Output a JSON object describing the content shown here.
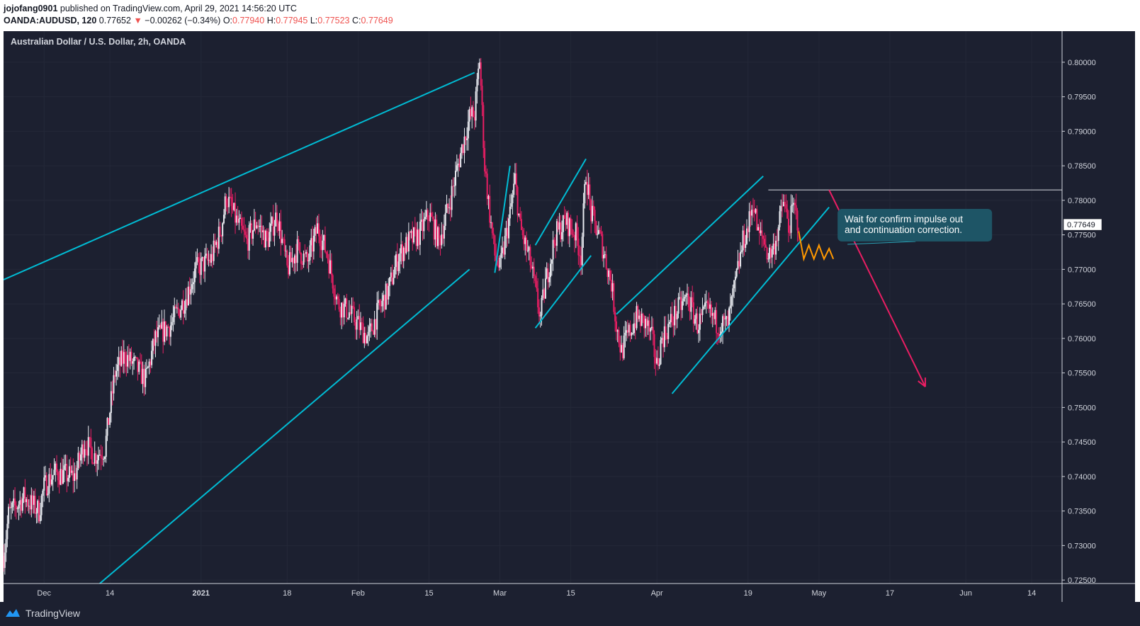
{
  "header": {
    "author": "jojofang0901",
    "published_text": "published on TradingView.com, April 29, 2021 14:56:20 UTC",
    "symbol": "OANDA:AUDUSD, 120",
    "last": "0.77652",
    "change": "−0.00262 (−0.34%)",
    "o_label": "O:",
    "o": "0.77940",
    "h_label": "H:",
    "h": "0.77945",
    "l_label": "L:",
    "l": "0.77523",
    "c_label": "C:",
    "c": "0.77649"
  },
  "footer": {
    "brand": "TradingView"
  },
  "colors": {
    "background": "#1c2030",
    "up": "#e8eaf0",
    "down": "#e91e63",
    "trendline": "#00bcd4",
    "arrow": "#e91e63",
    "wave": "#ff9800",
    "note_bg": "#1e5566"
  },
  "chart_data": {
    "type": "candlestick",
    "title": "Australian Dollar / U.S. Dollar, 2h, OANDA",
    "ylim": [
      0.7245,
      0.8045
    ],
    "y_ticks": [
      "0.80000",
      "0.79500",
      "0.79000",
      "0.78500",
      "0.78000",
      "0.77500",
      "0.77000",
      "0.76500",
      "0.76000",
      "0.75500",
      "0.75000",
      "0.74500",
      "0.74000",
      "0.73500",
      "0.73000",
      "0.72500"
    ],
    "y_tick_values": [
      0.8,
      0.795,
      0.79,
      0.785,
      0.78,
      0.775,
      0.77,
      0.765,
      0.76,
      0.755,
      0.75,
      0.745,
      0.74,
      0.735,
      0.73,
      0.725
    ],
    "x_ticks": [
      {
        "label": "Dec",
        "date": "2020-12-01",
        "bold": false
      },
      {
        "label": "14",
        "date": "2020-12-14",
        "bold": false
      },
      {
        "label": "2021",
        "date": "2021-01-01",
        "bold": true
      },
      {
        "label": "18",
        "date": "2021-01-18",
        "bold": false
      },
      {
        "label": "Feb",
        "date": "2021-02-01",
        "bold": false
      },
      {
        "label": "15",
        "date": "2021-02-15",
        "bold": false
      },
      {
        "label": "Mar",
        "date": "2021-03-01",
        "bold": false
      },
      {
        "label": "15",
        "date": "2021-03-15",
        "bold": false
      },
      {
        "label": "Apr",
        "date": "2021-04-01",
        "bold": false
      },
      {
        "label": "19",
        "date": "2021-04-19",
        "bold": false
      },
      {
        "label": "May",
        "date": "2021-05-03",
        "bold": false
      },
      {
        "label": "17",
        "date": "2021-05-17",
        "bold": false
      },
      {
        "label": "Jun",
        "date": "2021-06-01",
        "bold": false
      },
      {
        "label": "14",
        "date": "2021-06-14",
        "bold": false
      }
    ],
    "price_path": [
      {
        "date": "2020-11-23",
        "price": 0.7285
      },
      {
        "date": "2020-11-24",
        "price": 0.7345
      },
      {
        "date": "2020-11-27",
        "price": 0.737
      },
      {
        "date": "2020-11-30",
        "price": 0.735
      },
      {
        "date": "2020-12-01",
        "price": 0.7385
      },
      {
        "date": "2020-12-03",
        "price": 0.7405
      },
      {
        "date": "2020-12-07",
        "price": 0.74
      },
      {
        "date": "2020-12-09",
        "price": 0.745
      },
      {
        "date": "2020-12-11",
        "price": 0.743
      },
      {
        "date": "2020-12-13",
        "price": 0.744
      },
      {
        "date": "2020-12-15",
        "price": 0.755
      },
      {
        "date": "2020-12-17",
        "price": 0.7575
      },
      {
        "date": "2020-12-19",
        "price": 0.756
      },
      {
        "date": "2020-12-21",
        "price": 0.754
      },
      {
        "date": "2020-12-23",
        "price": 0.76
      },
      {
        "date": "2020-12-26",
        "price": 0.762
      },
      {
        "date": "2020-12-29",
        "price": 0.766
      },
      {
        "date": "2020-12-31",
        "price": 0.77
      },
      {
        "date": "2021-01-03",
        "price": 0.7715
      },
      {
        "date": "2021-01-05",
        "price": 0.776
      },
      {
        "date": "2021-01-06",
        "price": 0.7805
      },
      {
        "date": "2021-01-08",
        "price": 0.777
      },
      {
        "date": "2021-01-10",
        "price": 0.774
      },
      {
        "date": "2021-01-12",
        "price": 0.777
      },
      {
        "date": "2021-01-14",
        "price": 0.774
      },
      {
        "date": "2021-01-16",
        "price": 0.778
      },
      {
        "date": "2021-01-18",
        "price": 0.77
      },
      {
        "date": "2021-01-20",
        "price": 0.773
      },
      {
        "date": "2021-01-22",
        "price": 0.771
      },
      {
        "date": "2021-01-24",
        "price": 0.776
      },
      {
        "date": "2021-01-26",
        "price": 0.772
      },
      {
        "date": "2021-01-28",
        "price": 0.765
      },
      {
        "date": "2021-01-30",
        "price": 0.764
      },
      {
        "date": "2021-02-01",
        "price": 0.762
      },
      {
        "date": "2021-02-03",
        "price": 0.76
      },
      {
        "date": "2021-02-05",
        "price": 0.764
      },
      {
        "date": "2021-02-07",
        "price": 0.767
      },
      {
        "date": "2021-02-09",
        "price": 0.772
      },
      {
        "date": "2021-02-11",
        "price": 0.774
      },
      {
        "date": "2021-02-13",
        "price": 0.775
      },
      {
        "date": "2021-02-15",
        "price": 0.778
      },
      {
        "date": "2021-02-17",
        "price": 0.774
      },
      {
        "date": "2021-02-19",
        "price": 0.7795
      },
      {
        "date": "2021-02-21",
        "price": 0.786
      },
      {
        "date": "2021-02-23",
        "price": 0.792
      },
      {
        "date": "2021-02-24",
        "price": 0.7925
      },
      {
        "date": "2021-02-25",
        "price": 0.8005
      },
      {
        "date": "2021-02-26",
        "price": 0.785
      },
      {
        "date": "2021-02-27",
        "price": 0.778
      },
      {
        "date": "2021-02-28",
        "price": 0.772
      },
      {
        "date": "2021-03-01",
        "price": 0.77
      },
      {
        "date": "2021-03-03",
        "price": 0.778
      },
      {
        "date": "2021-03-04",
        "price": 0.783
      },
      {
        "date": "2021-03-05",
        "price": 0.776
      },
      {
        "date": "2021-03-07",
        "price": 0.771
      },
      {
        "date": "2021-03-09",
        "price": 0.763
      },
      {
        "date": "2021-03-10",
        "price": 0.768
      },
      {
        "date": "2021-03-12",
        "price": 0.775
      },
      {
        "date": "2021-03-14",
        "price": 0.777
      },
      {
        "date": "2021-03-16",
        "price": 0.775
      },
      {
        "date": "2021-03-17",
        "price": 0.772
      },
      {
        "date": "2021-03-18",
        "price": 0.784
      },
      {
        "date": "2021-03-19",
        "price": 0.778
      },
      {
        "date": "2021-03-21",
        "price": 0.774
      },
      {
        "date": "2021-03-23",
        "price": 0.768
      },
      {
        "date": "2021-03-24",
        "price": 0.762
      },
      {
        "date": "2021-03-25",
        "price": 0.758
      },
      {
        "date": "2021-03-26",
        "price": 0.76
      },
      {
        "date": "2021-03-28",
        "price": 0.763
      },
      {
        "date": "2021-03-30",
        "price": 0.762
      },
      {
        "date": "2021-03-31",
        "price": 0.76
      },
      {
        "date": "2021-04-01",
        "price": 0.756
      },
      {
        "date": "2021-04-02",
        "price": 0.76
      },
      {
        "date": "2021-04-05",
        "price": 0.764
      },
      {
        "date": "2021-04-07",
        "price": 0.766
      },
      {
        "date": "2021-04-09",
        "price": 0.762
      },
      {
        "date": "2021-04-11",
        "price": 0.764
      },
      {
        "date": "2021-04-13",
        "price": 0.762
      },
      {
        "date": "2021-04-15",
        "price": 0.762
      },
      {
        "date": "2021-04-16",
        "price": 0.766
      },
      {
        "date": "2021-04-18",
        "price": 0.774
      },
      {
        "date": "2021-04-19",
        "price": 0.776
      },
      {
        "date": "2021-04-20",
        "price": 0.78
      },
      {
        "date": "2021-04-21",
        "price": 0.775
      },
      {
        "date": "2021-04-22",
        "price": 0.7745
      },
      {
        "date": "2021-04-23",
        "price": 0.772
      },
      {
        "date": "2021-04-24",
        "price": 0.773
      },
      {
        "date": "2021-04-25",
        "price": 0.776
      },
      {
        "date": "2021-04-26",
        "price": 0.78
      },
      {
        "date": "2021-04-27",
        "price": 0.776
      },
      {
        "date": "2021-04-28",
        "price": 0.779
      },
      {
        "date": "2021-04-29",
        "price": 0.7765
      }
    ],
    "trendlines": [
      {
        "from": {
          "date": "2020-11-23",
          "price": 0.7685
        },
        "to": {
          "date": "2021-02-24",
          "price": 0.7985
        }
      },
      {
        "from": {
          "date": "2020-12-12",
          "price": 0.7245
        },
        "to": {
          "date": "2021-02-23",
          "price": 0.77
        }
      },
      {
        "from": {
          "date": "2021-02-28",
          "price": 0.7695
        },
        "to": {
          "date": "2021-03-03",
          "price": 0.785
        }
      },
      {
        "from": {
          "date": "2021-03-08",
          "price": 0.7735
        },
        "to": {
          "date": "2021-03-18",
          "price": 0.786
        }
      },
      {
        "from": {
          "date": "2021-03-08",
          "price": 0.7615
        },
        "to": {
          "date": "2021-03-19",
          "price": 0.772
        }
      },
      {
        "from": {
          "date": "2021-03-24",
          "price": 0.7635
        },
        "to": {
          "date": "2021-04-22",
          "price": 0.7835
        }
      },
      {
        "from": {
          "date": "2021-04-04",
          "price": 0.752
        },
        "to": {
          "date": "2021-05-05",
          "price": 0.779
        }
      }
    ],
    "resistance": {
      "price": 0.7815,
      "from_date": "2021-04-23"
    },
    "projection": {
      "from": {
        "date": "2021-05-05",
        "price": 0.7815
      },
      "to": {
        "date": "2021-05-24",
        "price": 0.753
      }
    },
    "projected_wave": [
      {
        "date": "2021-04-29",
        "price": 0.7755
      },
      {
        "date": "2021-04-30",
        "price": 0.7715
      },
      {
        "date": "2021-05-01",
        "price": 0.7735
      },
      {
        "date": "2021-05-02",
        "price": 0.7715
      },
      {
        "date": "2021-05-03",
        "price": 0.7735
      },
      {
        "date": "2021-05-04",
        "price": 0.7715
      },
      {
        "date": "2021-05-05",
        "price": 0.773
      },
      {
        "date": "2021-05-05",
        "price": 0.7715
      }
    ],
    "annotation": {
      "lines": [
        "Wait for confirm impulse out",
        "and continuation correction."
      ],
      "anchor": {
        "date": "2021-05-05",
        "price": 0.7765
      }
    },
    "last_price_label": "0.77649",
    "last_price": 0.77649
  }
}
